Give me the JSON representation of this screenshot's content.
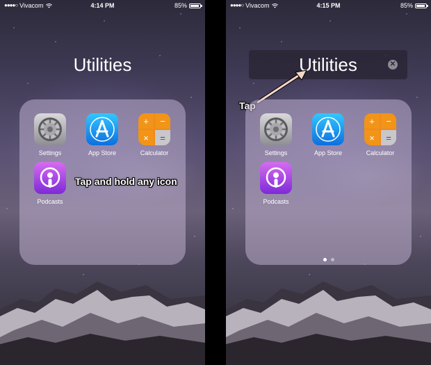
{
  "status_bar": {
    "carrier_signal": "●●●●○",
    "carrier": "Vivacom",
    "battery": "85%",
    "battery_level": 0.85
  },
  "screens": [
    {
      "time": "4:14 PM",
      "folder_title": "Utilities",
      "annotation": "Tap and hold any icon",
      "apps": [
        {
          "label": "Settings",
          "icon": "settings-icon"
        },
        {
          "label": "App Store",
          "icon": "app-store-icon"
        },
        {
          "label": "Calculator",
          "icon": "calculator-icon"
        },
        {
          "label": "Podcasts",
          "icon": "podcasts-icon"
        }
      ]
    },
    {
      "time": "4:15 PM",
      "folder_title": "Utilities",
      "annotation": "Tap",
      "apps": [
        {
          "label": "Settings",
          "icon": "settings-icon"
        },
        {
          "label": "App Store",
          "icon": "app-store-icon"
        },
        {
          "label": "Calculator",
          "icon": "calculator-icon"
        },
        {
          "label": "Podcasts",
          "icon": "podcasts-icon"
        }
      ],
      "page_count": 2,
      "active_page": 1
    }
  ],
  "calculator_keys": [
    "+",
    "−",
    "×",
    "="
  ]
}
